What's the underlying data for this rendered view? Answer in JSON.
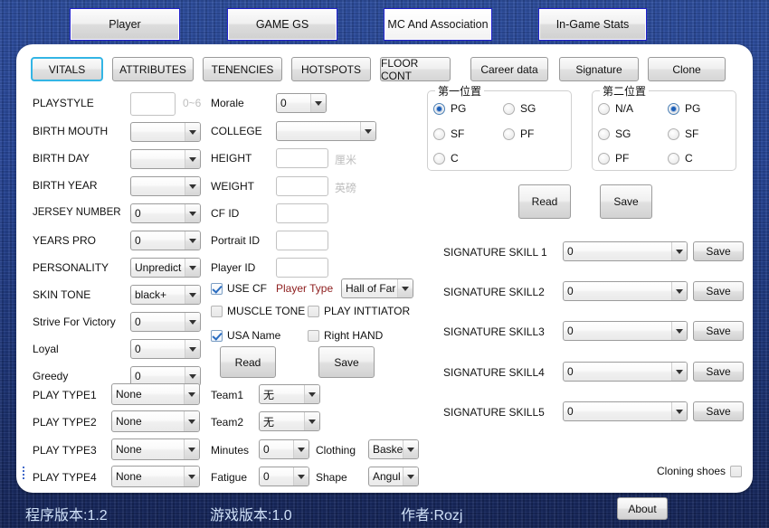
{
  "window": {
    "bg_color": "#1f3b82",
    "panel_color": "#ffffff"
  },
  "top_tabs": [
    {
      "label": "Player",
      "selected": false
    },
    {
      "label": "GAME GS",
      "selected": false
    },
    {
      "label": "MC And Association",
      "selected": true
    },
    {
      "label": "In-Game Stats",
      "selected": false
    }
  ],
  "sub_tabs": [
    {
      "label": "VITALS",
      "selected": true
    },
    {
      "label": "ATTRIBUTES",
      "selected": false
    },
    {
      "label": "TENENCIES",
      "selected": false
    },
    {
      "label": "HOTSPOTS",
      "selected": false
    },
    {
      "label": "FLOOR CONT",
      "selected": false
    },
    {
      "label": "Career data",
      "selected": false
    },
    {
      "label": "Signature",
      "selected": false
    },
    {
      "label": "Clone",
      "selected": false
    }
  ],
  "left_column": {
    "playstyle": {
      "label": "PLAYSTYLE",
      "value": "",
      "hint": "0~6"
    },
    "fields": [
      {
        "label": "BIRTH MOUTH",
        "value": ""
      },
      {
        "label": "BIRTH DAY",
        "value": ""
      },
      {
        "label": "BIRTH YEAR",
        "value": ""
      },
      {
        "label": "JERSEY NUMBER",
        "value": "0"
      },
      {
        "label": "YEARS PRO",
        "value": "0"
      },
      {
        "label": "PERSONALITY",
        "value": "Unpredict"
      },
      {
        "label": "SKIN TONE",
        "value": "black+"
      },
      {
        "label": "Strive For Victory",
        "value": "0"
      },
      {
        "label": "Loyal",
        "value": "0"
      },
      {
        "label": "Greedy",
        "value": "0"
      }
    ],
    "play_types": [
      {
        "label": "PLAY TYPE1",
        "value": "None"
      },
      {
        "label": "PLAY TYPE2",
        "value": "None"
      },
      {
        "label": "PLAY TYPE3",
        "value": "None"
      },
      {
        "label": "PLAY TYPE4",
        "value": "None"
      }
    ]
  },
  "middle_column": {
    "morale": {
      "label": "Morale",
      "value": "0"
    },
    "college": {
      "label": "COLLEGE",
      "value": ""
    },
    "height": {
      "label": "HEIGHT",
      "value": "",
      "unit": "厘米"
    },
    "weight": {
      "label": "WEIGHT",
      "value": "",
      "unit": "英磅"
    },
    "cf_id": {
      "label": "CF ID",
      "value": ""
    },
    "portrait_id": {
      "label": "Portrait ID",
      "value": ""
    },
    "player_id": {
      "label": "Player ID",
      "value": ""
    },
    "use_cf": {
      "label": "USE CF",
      "checked": true
    },
    "muscle_tone": {
      "label": "MUSCLE TONE",
      "checked": false
    },
    "play_initiator": {
      "label": "PLAY INTTIATOR",
      "checked": false
    },
    "usa_name": {
      "label": "USA Name",
      "checked": true
    },
    "right_hand": {
      "label": "Right HAND",
      "checked": false
    },
    "player_type": {
      "label": "Player Type",
      "value": "Hall of Far",
      "label_color": "#8f2020"
    },
    "read_button": "Read",
    "save_button": "Save",
    "team1": {
      "label": "Team1",
      "value": "无"
    },
    "team2": {
      "label": "Team2",
      "value": "无"
    },
    "minutes": {
      "label": "Minutes",
      "value": "0"
    },
    "fatigue": {
      "label": "Fatigue",
      "value": "0"
    },
    "clothing": {
      "label": "Clothing",
      "value": "Basket"
    },
    "shape": {
      "label": "Shape",
      "value": "Angul"
    }
  },
  "right_column": {
    "pos1": {
      "title": "第一位置",
      "options": [
        {
          "label": "PG",
          "selected": true
        },
        {
          "label": "SG",
          "selected": false
        },
        {
          "label": "SF",
          "selected": false
        },
        {
          "label": "PF",
          "selected": false
        },
        {
          "label": "C",
          "selected": false
        }
      ]
    },
    "pos2": {
      "title": "第二位置",
      "options": [
        {
          "label": "N/A",
          "selected": false
        },
        {
          "label": "PG",
          "selected": true
        },
        {
          "label": "SG",
          "selected": false
        },
        {
          "label": "SF",
          "selected": false
        },
        {
          "label": "PF",
          "selected": false
        },
        {
          "label": "C",
          "selected": false
        }
      ]
    },
    "read_button": "Read",
    "save_button": "Save",
    "signature_skills": [
      {
        "label": "SIGNATURE SKILL 1",
        "value": "0",
        "save": "Save"
      },
      {
        "label": "SIGNATURE SKILL2",
        "value": "0",
        "save": "Save"
      },
      {
        "label": "SIGNATURE SKILL3",
        "value": "0",
        "save": "Save"
      },
      {
        "label": "SIGNATURE SKILL4",
        "value": "0",
        "save": "Save"
      },
      {
        "label": "SIGNATURE SKILL5",
        "value": "0",
        "save": "Save"
      }
    ],
    "cloning_shoes": {
      "label": "Cloning shoes",
      "checked": false
    }
  },
  "footer": {
    "program_version": "程序版本:1.2",
    "game_version": "游戏版本:1.0",
    "author": "作者:Rozj",
    "about_button": "About"
  }
}
